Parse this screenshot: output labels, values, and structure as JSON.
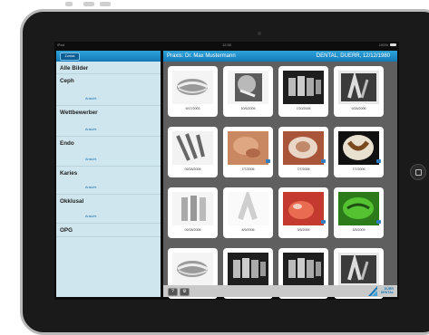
{
  "status_bar": {
    "left": "iPad",
    "center": "12:30",
    "right": "100%"
  },
  "left_panel": {
    "back_button": "Zurück",
    "categories": [
      {
        "name": "Alle Bilder",
        "ansicht": ""
      },
      {
        "name": "Ceph",
        "ansicht": "Ansicht"
      },
      {
        "name": "Wettbewerber",
        "ansicht": "Ansicht"
      },
      {
        "name": "Endo",
        "ansicht": "Ansicht"
      },
      {
        "name": "Karies",
        "ansicht": "Ansicht"
      },
      {
        "name": "Okklusal",
        "ansicht": "Ansicht"
      },
      {
        "name": "OPG",
        "ansicht": ""
      }
    ]
  },
  "right_panel": {
    "praxis": "Praxis: Dr. Max Mustermann",
    "patient": "DENTAL, DUERR, 12/12/1980",
    "images": [
      {
        "date": "9/17/2003",
        "kind": "xray-pano"
      },
      {
        "date": "10/5/2005",
        "kind": "xray-ceph"
      },
      {
        "date": "7/20/2006",
        "kind": "xray-teeth"
      },
      {
        "date": "9/28/2006",
        "kind": "xray-tooth"
      },
      {
        "date": "09/28/2006",
        "kind": "xray-roots"
      },
      {
        "date": "7/7/2006",
        "kind": "photo-gum"
      },
      {
        "date": "7/7/2006",
        "kind": "photo-tooth"
      },
      {
        "date": "7/7/2006",
        "kind": "photo-dark"
      },
      {
        "date": "09/28/2006",
        "kind": "xray-incisor"
      },
      {
        "date": "8/9/2006",
        "kind": "xray-white"
      },
      {
        "date": "3/5/2009",
        "kind": "photo-red"
      },
      {
        "date": "3/5/2009",
        "kind": "photo-green"
      },
      {
        "date": "",
        "kind": "xray-pano"
      },
      {
        "date": "",
        "kind": "xray-teeth"
      },
      {
        "date": "",
        "kind": "xray-teeth"
      },
      {
        "date": "",
        "kind": "xray-tooth"
      }
    ],
    "footer_buttons": [
      "?",
      "⚙"
    ],
    "logo": {
      "line1": "DÜRR",
      "line2": "DENTAL"
    }
  },
  "colors": {
    "accent": "#1479b8",
    "panel": "#cfe6ee",
    "grid_bg": "#5f5f5f"
  }
}
